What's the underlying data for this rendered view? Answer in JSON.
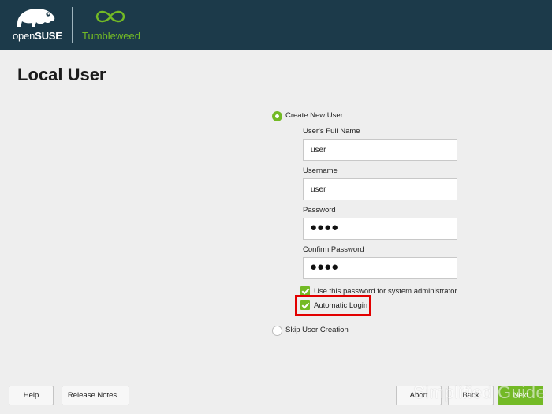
{
  "header": {
    "brand_prefix": "open",
    "brand_suffix": "SUSE",
    "product_name": "Tumbleweed",
    "colors": {
      "background": "#1c3a4a",
      "accent": "#73ba25"
    }
  },
  "page": {
    "title": "Local User"
  },
  "form": {
    "create_new_user": {
      "label": "Create New User",
      "selected": true
    },
    "full_name": {
      "label": "User's Full Name",
      "value": "user"
    },
    "username": {
      "label": "Username",
      "value": "user"
    },
    "password": {
      "label": "Password",
      "value": "●●●●"
    },
    "confirm_password": {
      "label": "Confirm Password",
      "value": "●●●●"
    },
    "use_for_admin": {
      "label": "Use this password for system administrator",
      "checked": true
    },
    "automatic_login": {
      "label": "Automatic Login",
      "checked": true,
      "highlighted": true
    },
    "skip_user_creation": {
      "label": "Skip User Creation",
      "selected": false
    }
  },
  "footer": {
    "help": "Help",
    "release_notes": "Release Notes...",
    "abort": "Abort",
    "back": "Back",
    "next": "Next"
  },
  "watermark": "Simplified Guide"
}
